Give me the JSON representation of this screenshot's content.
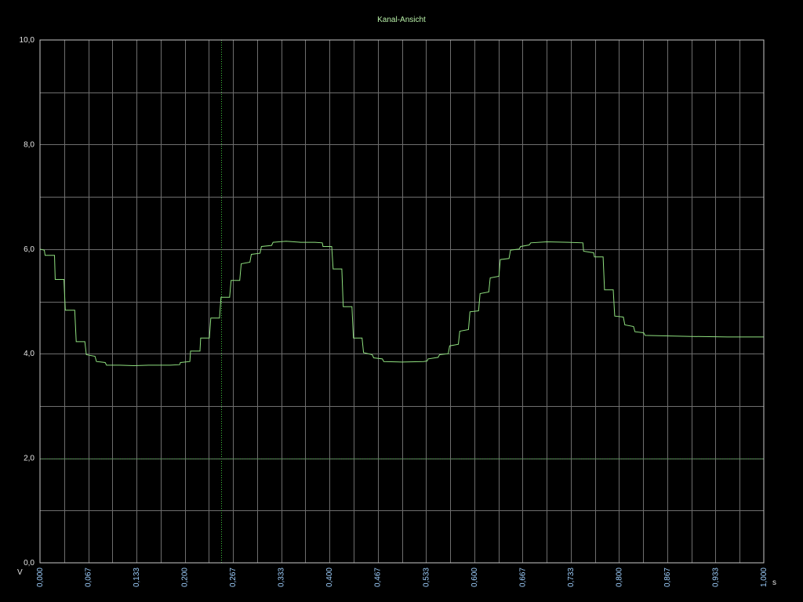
{
  "chart_data": {
    "type": "line",
    "title": "Kanal-Ansicht",
    "ylabel": "V",
    "xlabel": "s",
    "xlim": [
      0,
      1
    ],
    "ylim": [
      0,
      10
    ],
    "grid": true,
    "legend": "none",
    "y_ticks": [
      "0,0",
      "2,0",
      "4,0",
      "6,0",
      "8,0",
      "10,0"
    ],
    "x_ticks": [
      "0,000",
      "0,067",
      "0,133",
      "0,200",
      "0,267",
      "0,333",
      "0,400",
      "0,467",
      "0,533",
      "0,600",
      "0,667",
      "0,733",
      "0,800",
      "0,867",
      "0,933",
      "1,000"
    ],
    "markers": {
      "cursor_x": 0.25,
      "reference_y": 2.0
    },
    "colors": {
      "background": "#000000",
      "trace": "#8fe07f",
      "grid": "#6e6e6e",
      "title": "#b8f0a8",
      "x_ticks": "#9fd0ff",
      "cursor": "#3fbf3f"
    },
    "series": [
      {
        "values": [
          [
            0.0,
            6.0
          ],
          [
            0.006,
            5.98
          ],
          [
            0.007,
            5.88
          ],
          [
            0.02,
            5.88
          ],
          [
            0.021,
            5.42
          ],
          [
            0.033,
            5.42
          ],
          [
            0.035,
            4.83
          ],
          [
            0.048,
            4.83
          ],
          [
            0.05,
            4.23
          ],
          [
            0.062,
            4.23
          ],
          [
            0.064,
            3.98
          ],
          [
            0.076,
            3.95
          ],
          [
            0.078,
            3.85
          ],
          [
            0.09,
            3.83
          ],
          [
            0.092,
            3.78
          ],
          [
            0.11,
            3.78
          ],
          [
            0.13,
            3.77
          ],
          [
            0.15,
            3.78
          ],
          [
            0.18,
            3.78
          ],
          [
            0.193,
            3.79
          ],
          [
            0.194,
            3.83
          ],
          [
            0.207,
            3.85
          ],
          [
            0.208,
            4.05
          ],
          [
            0.221,
            4.05
          ],
          [
            0.222,
            4.3
          ],
          [
            0.234,
            4.3
          ],
          [
            0.236,
            4.68
          ],
          [
            0.248,
            4.68
          ],
          [
            0.25,
            5.08
          ],
          [
            0.262,
            5.08
          ],
          [
            0.264,
            5.4
          ],
          [
            0.276,
            5.4
          ],
          [
            0.278,
            5.72
          ],
          [
            0.29,
            5.75
          ],
          [
            0.292,
            5.9
          ],
          [
            0.304,
            5.92
          ],
          [
            0.306,
            6.05
          ],
          [
            0.32,
            6.07
          ],
          [
            0.322,
            6.13
          ],
          [
            0.34,
            6.15
          ],
          [
            0.36,
            6.13
          ],
          [
            0.38,
            6.13
          ],
          [
            0.39,
            6.12
          ],
          [
            0.391,
            6.05
          ],
          [
            0.403,
            6.05
          ],
          [
            0.405,
            5.62
          ],
          [
            0.417,
            5.62
          ],
          [
            0.419,
            4.9
          ],
          [
            0.431,
            4.9
          ],
          [
            0.433,
            4.3
          ],
          [
            0.445,
            4.3
          ],
          [
            0.447,
            4.02
          ],
          [
            0.459,
            3.98
          ],
          [
            0.461,
            3.92
          ],
          [
            0.473,
            3.9
          ],
          [
            0.475,
            3.85
          ],
          [
            0.5,
            3.84
          ],
          [
            0.53,
            3.85
          ],
          [
            0.535,
            3.86
          ],
          [
            0.536,
            3.9
          ],
          [
            0.55,
            3.93
          ],
          [
            0.552,
            3.98
          ],
          [
            0.564,
            4.0
          ],
          [
            0.566,
            4.15
          ],
          [
            0.578,
            4.18
          ],
          [
            0.58,
            4.43
          ],
          [
            0.592,
            4.46
          ],
          [
            0.594,
            4.8
          ],
          [
            0.606,
            4.82
          ],
          [
            0.608,
            5.15
          ],
          [
            0.62,
            5.18
          ],
          [
            0.622,
            5.45
          ],
          [
            0.634,
            5.48
          ],
          [
            0.636,
            5.8
          ],
          [
            0.648,
            5.82
          ],
          [
            0.65,
            5.98
          ],
          [
            0.662,
            6.0
          ],
          [
            0.664,
            6.05
          ],
          [
            0.676,
            6.08
          ],
          [
            0.678,
            6.12
          ],
          [
            0.7,
            6.14
          ],
          [
            0.73,
            6.13
          ],
          [
            0.75,
            6.12
          ],
          [
            0.751,
            5.96
          ],
          [
            0.765,
            5.93
          ],
          [
            0.766,
            5.85
          ],
          [
            0.778,
            5.85
          ],
          [
            0.78,
            5.22
          ],
          [
            0.792,
            5.22
          ],
          [
            0.794,
            4.72
          ],
          [
            0.806,
            4.7
          ],
          [
            0.808,
            4.55
          ],
          [
            0.82,
            4.52
          ],
          [
            0.822,
            4.42
          ],
          [
            0.834,
            4.4
          ],
          [
            0.836,
            4.35
          ],
          [
            0.9,
            4.33
          ],
          [
            0.95,
            4.32
          ],
          [
            1.0,
            4.32
          ]
        ]
      }
    ]
  }
}
